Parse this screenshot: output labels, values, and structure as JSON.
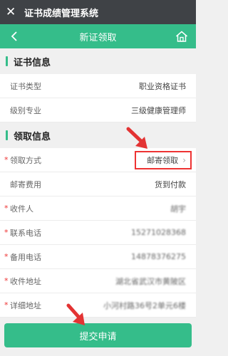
{
  "appbar": {
    "title": "证书成绩管理系统"
  },
  "navbar": {
    "title": "新证领取"
  },
  "cert_section": {
    "title": "证书信息",
    "rows": [
      {
        "label": "证书类型",
        "value": "职业资格证书"
      },
      {
        "label": "级别专业",
        "value": "三级健康管理师"
      }
    ]
  },
  "pickup_section": {
    "title": "领取信息",
    "method": {
      "label": "领取方式",
      "value": "邮寄领取"
    },
    "fee": {
      "label": "邮寄费用",
      "value": "货到付款"
    },
    "recipient": {
      "label": "收件人",
      "value": "胡宇"
    },
    "phone": {
      "label": "联系电话",
      "value": "15271028368"
    },
    "backup_phone": {
      "label": "备用电话",
      "value": "14878376275"
    },
    "address": {
      "label": "收件地址",
      "value": "湖北省武汉市黄陂区"
    },
    "detail_address": {
      "label": "详细地址",
      "value": "小河村路36号2单元6楼"
    }
  },
  "submit": {
    "label": "提交申请"
  },
  "colors": {
    "accent": "#35bd8a",
    "appbar": "#3f4246",
    "annotation": "#e33333"
  },
  "icons": {
    "close": "close-icon",
    "back": "back-icon",
    "home": "home-icon",
    "chevron": "chevron-right-icon"
  }
}
